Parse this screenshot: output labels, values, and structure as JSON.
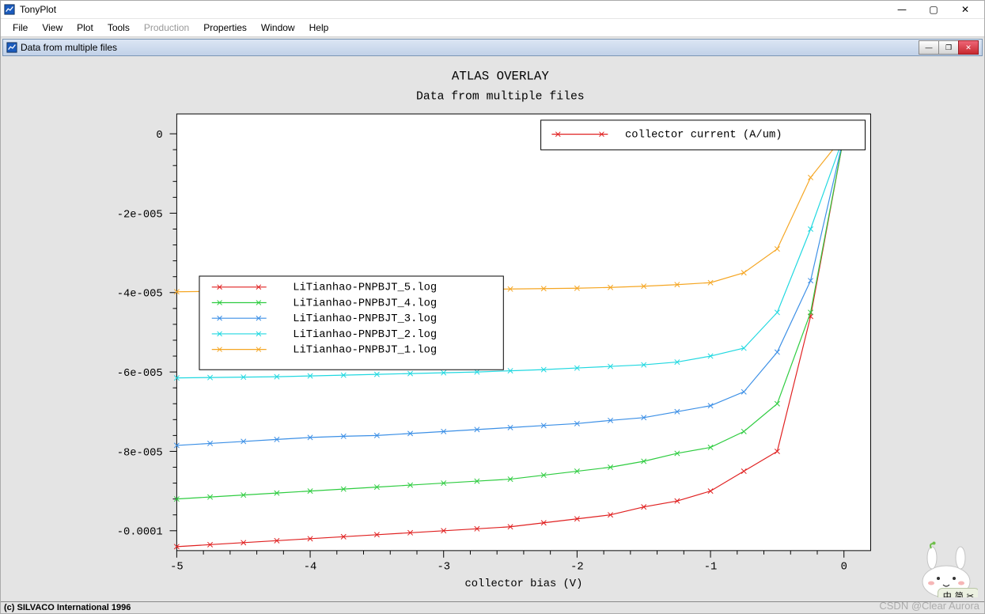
{
  "app": {
    "title": "TonyPlot"
  },
  "window_buttons": {
    "min": "—",
    "max": "▢",
    "close": "✕"
  },
  "menu": {
    "items": [
      "File",
      "View",
      "Plot",
      "Tools",
      "Production",
      "Properties",
      "Window",
      "Help"
    ],
    "disabled_index": 4
  },
  "child": {
    "title": "Data from multiple files",
    "buttons": {
      "min": "—",
      "max": "❐",
      "close": "✕"
    }
  },
  "status": {
    "text": "(c) SILVACO International 1996"
  },
  "watermark": "CSDN @Clear Aurora",
  "ime": {
    "a": "中",
    "b": "简"
  },
  "chart_data": {
    "type": "line",
    "title": "ATLAS OVERLAY",
    "subtitle": "Data from multiple files",
    "xlabel": "collector bias (V)",
    "ylabel": "",
    "legend_title": "collector current (A/um)",
    "x": [
      -5,
      -4.75,
      -4.5,
      -4.25,
      -4,
      -3.75,
      -3.5,
      -3.25,
      -3,
      -2.75,
      -2.5,
      -2.25,
      -2,
      -1.75,
      -1.5,
      -1.25,
      -1,
      -0.75,
      -0.5,
      -0.25,
      0,
      0.1
    ],
    "series": [
      {
        "name": "LiTianhao-PNPBJT_5.log",
        "color": "#e02020",
        "values": [
          -0.000104,
          -0.0001035,
          -0.000103,
          -0.0001025,
          -0.000102,
          -0.0001015,
          -0.000101,
          -0.0001005,
          -0.0001,
          -9.95e-05,
          -9.9e-05,
          -9.8e-05,
          -9.7e-05,
          -9.6e-05,
          -9.4e-05,
          -9.25e-05,
          -9e-05,
          -8.5e-05,
          -8e-05,
          -4.6e-05,
          -5e-07,
          1.5e-06
        ]
      },
      {
        "name": "LiTianhao-PNPBJT_4.log",
        "color": "#2ecc40",
        "values": [
          -9.2e-05,
          -9.15e-05,
          -9.1e-05,
          -9.05e-05,
          -9e-05,
          -8.95e-05,
          -8.9e-05,
          -8.85e-05,
          -8.8e-05,
          -8.75e-05,
          -8.7e-05,
          -8.6e-05,
          -8.5e-05,
          -8.4e-05,
          -8.25e-05,
          -8.05e-05,
          -7.9e-05,
          -7.5e-05,
          -6.8e-05,
          -4.5e-05,
          -5e-07,
          1.5e-06
        ]
      },
      {
        "name": "LiTianhao-PNPBJT_3.log",
        "color": "#3b8fe6",
        "values": [
          -7.85e-05,
          -7.8e-05,
          -7.75e-05,
          -7.7e-05,
          -7.65e-05,
          -7.62e-05,
          -7.6e-05,
          -7.55e-05,
          -7.5e-05,
          -7.45e-05,
          -7.4e-05,
          -7.35e-05,
          -7.3e-05,
          -7.22e-05,
          -7.15e-05,
          -7e-05,
          -6.85e-05,
          -6.5e-05,
          -5.5e-05,
          -3.7e-05,
          -5e-07,
          1.5e-06
        ]
      },
      {
        "name": "LiTianhao-PNPBJT_2.log",
        "color": "#20d8e0",
        "values": [
          -6.15e-05,
          -6.14e-05,
          -6.13e-05,
          -6.12e-05,
          -6.1e-05,
          -6.08e-05,
          -6.06e-05,
          -6.04e-05,
          -6.02e-05,
          -6e-05,
          -5.97e-05,
          -5.94e-05,
          -5.9e-05,
          -5.86e-05,
          -5.82e-05,
          -5.75e-05,
          -5.6e-05,
          -5.4e-05,
          -4.5e-05,
          -2.4e-05,
          -5e-07,
          1.5e-06
        ]
      },
      {
        "name": "LiTianhao-PNPBJT_1.log",
        "color": "#f5a623",
        "values": [
          -3.98e-05,
          -3.97e-05,
          -3.97e-05,
          -3.96e-05,
          -3.96e-05,
          -3.95e-05,
          -3.95e-05,
          -3.94e-05,
          -3.93e-05,
          -3.92e-05,
          -3.91e-05,
          -3.9e-05,
          -3.89e-05,
          -3.87e-05,
          -3.84e-05,
          -3.8e-05,
          -3.75e-05,
          -3.5e-05,
          -2.9e-05,
          -1.1e-05,
          -5e-07,
          1.5e-06
        ]
      }
    ],
    "xlim": [
      -5,
      0.2
    ],
    "ylim": [
      -0.000105,
      5e-06
    ],
    "yticks_major": [
      0,
      -2e-05,
      -4e-05,
      -6e-05,
      -8e-05,
      -0.0001
    ],
    "ytick_labels": [
      "0",
      "-2e-005",
      "-4e-005",
      "-6e-005",
      "-8e-005",
      "-0.0001"
    ],
    "xticks_major": [
      -5,
      -4,
      -3,
      -2,
      -1,
      0
    ],
    "xtick_labels": [
      "-5",
      "-4",
      "-3",
      "-2",
      "-1",
      "0"
    ]
  }
}
